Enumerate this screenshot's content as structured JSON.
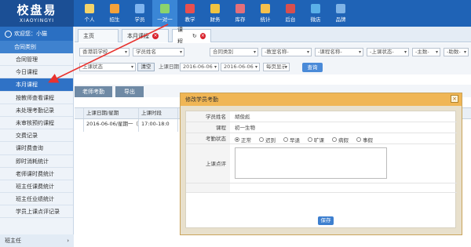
{
  "logo": {
    "cn": "校盘易",
    "en": "XIAOYINGYI"
  },
  "nav": [
    {
      "label": "个人",
      "color": "#f3d36a"
    },
    {
      "label": "招生",
      "color": "#f5a23b"
    },
    {
      "label": "学员",
      "color": "#7fb4ef"
    },
    {
      "label": "一对一",
      "color": "#8bd46d"
    },
    {
      "label": "教学",
      "color": "#e94f4f"
    },
    {
      "label": "财务",
      "color": "#f0c341"
    },
    {
      "label": "库存",
      "color": "#e46f7a"
    },
    {
      "label": "统计",
      "color": "#f6c04c"
    },
    {
      "label": "后台",
      "color": "#d84f4f"
    },
    {
      "label": "微店",
      "color": "#5bb0e8"
    },
    {
      "label": "品牌",
      "color": "#7fb3e6"
    }
  ],
  "sidebar": {
    "welcome": "欢迎您：小猫",
    "section": "合同类别",
    "items": [
      "合同管理",
      "今日课程",
      "本月课程",
      "按教师查看课程",
      "未处理考勤记录",
      "未审核预约课程",
      "交费记录",
      "课时费查询",
      "即时消耗统计",
      "老师课时费统计",
      "班主任课费统计",
      "班主任业绩统计",
      "学员上课点评记录"
    ],
    "active_index": 2,
    "footer": "班主任",
    "footer_arrow": "›"
  },
  "tabs": [
    {
      "label": "主页",
      "closable": false
    },
    {
      "label": "本月课程",
      "closable": true
    },
    {
      "label": "课程",
      "closable": true
    }
  ],
  "filters": {
    "row1": [
      "香港前学校",
      "学员姓名",
      "合同类别",
      "-教室名称-",
      "-课程名称-",
      "-上课状态-",
      "-主数-",
      "-助数-"
    ],
    "row2_first": "上课状态",
    "clear_label": "清空",
    "date_label": "上课日期",
    "date_from": "2016-06-06",
    "date_to": "2016-06-06",
    "page_size": "每页显示",
    "query_label": "查询"
  },
  "actions": {
    "teacher_attendance": "老师考勤",
    "export": "导出"
  },
  "grid": {
    "headers": [
      "",
      "上课日期/星期",
      "上课时段"
    ],
    "row": [
      "",
      "2016-06-06/星期一（本上）",
      "17:00-18:0"
    ]
  },
  "dialog": {
    "title": "修改学员考勤",
    "close": "×",
    "student_label": "学员姓名",
    "student_value": "胡俊彪",
    "course_label": "课程",
    "course_value": "初一生物",
    "status_label": "考勤状态",
    "statuses": [
      "正常",
      "迟到",
      "早退",
      "旷课",
      "病假",
      "事假"
    ],
    "status_selected": 0,
    "comment_label": "上课点评",
    "save": "保存"
  },
  "colors": {
    "header": "#1f63b6",
    "sidebar_active": "#2f72c6",
    "dialog_title": "#f0b655",
    "arrow": "#e8322e"
  }
}
